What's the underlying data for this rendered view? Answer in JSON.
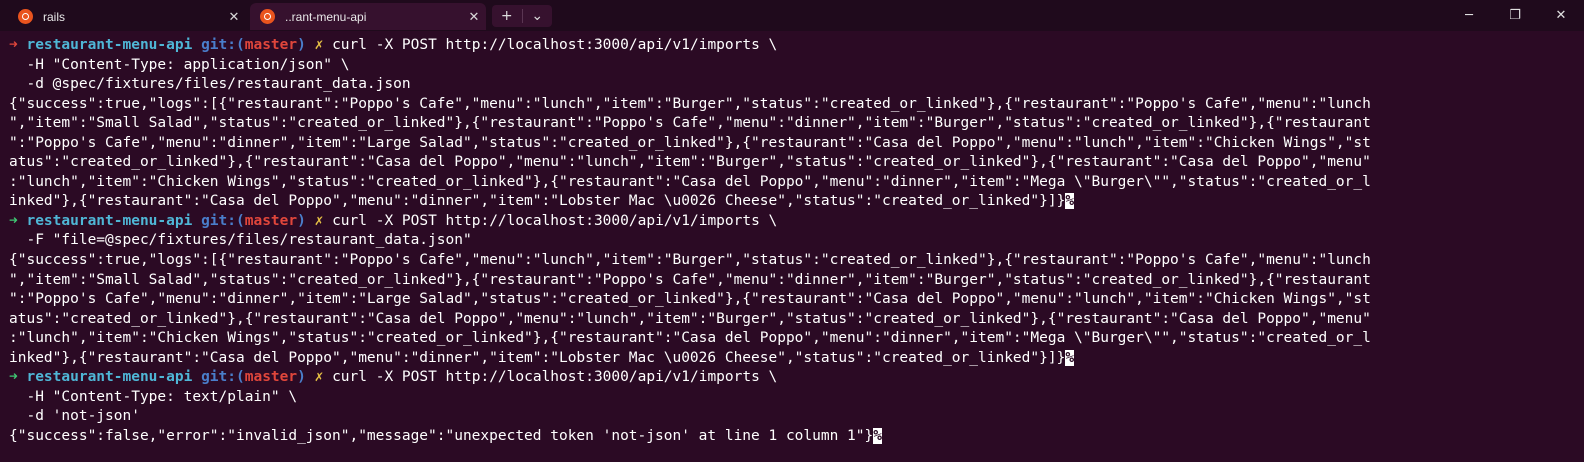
{
  "tabs": [
    {
      "label": "rails",
      "icon": "ubuntu-icon",
      "active": false
    },
    {
      "label": "..rant-menu-api",
      "icon": "ubuntu-icon",
      "active": true
    }
  ],
  "window_controls": {
    "new_tab": "+",
    "dropdown": "⌄",
    "minimize": "─",
    "maximize": "❐",
    "close": "✕"
  },
  "prompt": {
    "arrow": "➜",
    "dir": "restaurant-menu-api",
    "git_label": "git:(",
    "branch": "master",
    "git_close": ")",
    "dirty": "✗"
  },
  "blocks": [
    {
      "arrow_color": "red",
      "command": "curl -X POST http://localhost:3000/api/v1/imports \\",
      "continuation": [
        "  -H \"Content-Type: application/json\" \\",
        "  -d @spec/fixtures/files/restaurant_data.json"
      ],
      "output": [
        "{\"success\":true,\"logs\":[{\"restaurant\":\"Poppo's Cafe\",\"menu\":\"lunch\",\"item\":\"Burger\",\"status\":\"created_or_linked\"},{\"restaurant\":\"Poppo's Cafe\",\"menu\":\"lunch",
        "\",\"item\":\"Small Salad\",\"status\":\"created_or_linked\"},{\"restaurant\":\"Poppo's Cafe\",\"menu\":\"dinner\",\"item\":\"Burger\",\"status\":\"created_or_linked\"},{\"restaurant",
        "\":\"Poppo's Cafe\",\"menu\":\"dinner\",\"item\":\"Large Salad\",\"status\":\"created_or_linked\"},{\"restaurant\":\"Casa del Poppo\",\"menu\":\"lunch\",\"item\":\"Chicken Wings\",\"st",
        "atus\":\"created_or_linked\"},{\"restaurant\":\"Casa del Poppo\",\"menu\":\"lunch\",\"item\":\"Burger\",\"status\":\"created_or_linked\"},{\"restaurant\":\"Casa del Poppo\",\"menu\"",
        ":\"lunch\",\"item\":\"Chicken Wings\",\"status\":\"created_or_linked\"},{\"restaurant\":\"Casa del Poppo\",\"menu\":\"dinner\",\"item\":\"Mega \\\"Burger\\\"\",\"status\":\"created_or_l",
        "inked\"},{\"restaurant\":\"Casa del Poppo\",\"menu\":\"dinner\",\"item\":\"Lobster Mac \\u0026 Cheese\",\"status\":\"created_or_linked\"}]}"
      ],
      "eol_mark": "%"
    },
    {
      "arrow_color": "green",
      "command": "curl -X POST http://localhost:3000/api/v1/imports \\",
      "continuation": [
        "  -F \"file=@spec/fixtures/files/restaurant_data.json\""
      ],
      "output": [
        "{\"success\":true,\"logs\":[{\"restaurant\":\"Poppo's Cafe\",\"menu\":\"lunch\",\"item\":\"Burger\",\"status\":\"created_or_linked\"},{\"restaurant\":\"Poppo's Cafe\",\"menu\":\"lunch",
        "\",\"item\":\"Small Salad\",\"status\":\"created_or_linked\"},{\"restaurant\":\"Poppo's Cafe\",\"menu\":\"dinner\",\"item\":\"Burger\",\"status\":\"created_or_linked\"},{\"restaurant",
        "\":\"Poppo's Cafe\",\"menu\":\"dinner\",\"item\":\"Large Salad\",\"status\":\"created_or_linked\"},{\"restaurant\":\"Casa del Poppo\",\"menu\":\"lunch\",\"item\":\"Chicken Wings\",\"st",
        "atus\":\"created_or_linked\"},{\"restaurant\":\"Casa del Poppo\",\"menu\":\"lunch\",\"item\":\"Burger\",\"status\":\"created_or_linked\"},{\"restaurant\":\"Casa del Poppo\",\"menu\"",
        ":\"lunch\",\"item\":\"Chicken Wings\",\"status\":\"created_or_linked\"},{\"restaurant\":\"Casa del Poppo\",\"menu\":\"dinner\",\"item\":\"Mega \\\"Burger\\\"\",\"status\":\"created_or_l",
        "inked\"},{\"restaurant\":\"Casa del Poppo\",\"menu\":\"dinner\",\"item\":\"Lobster Mac \\u0026 Cheese\",\"status\":\"created_or_linked\"}]}"
      ],
      "eol_mark": "%"
    },
    {
      "arrow_color": "green",
      "command": "curl -X POST http://localhost:3000/api/v1/imports \\",
      "continuation": [
        "  -H \"Content-Type: text/plain\" \\",
        "  -d 'not-json'"
      ],
      "output": [
        "{\"success\":false,\"error\":\"invalid_json\",\"message\":\"unexpected token 'not-json' at line 1 column 1\"}"
      ],
      "eol_mark": "%"
    }
  ],
  "colors": {
    "background": "#2b0a24",
    "prompt_dir": "#4fb6d6",
    "git_label": "#4a7ecb",
    "branch": "#e0463b",
    "dirty_mark": "#e6c145",
    "arrow_fail": "#e0463b",
    "arrow_ok": "#3fc672"
  }
}
